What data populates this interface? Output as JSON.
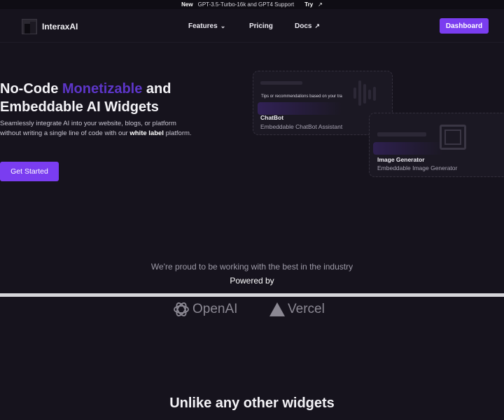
{
  "announcement": {
    "badge": "New",
    "text": "GPT-3.5-Turbo-16k and GPT4 Support",
    "link": "Try",
    "link_icon": "arrow-up-right-icon"
  },
  "nav": {
    "brand": "InteraxAI",
    "features": "Features",
    "pricing": "Pricing",
    "docs": "Docs",
    "dashboard": "Dashboard"
  },
  "hero": {
    "title_part1": "No-Code ",
    "title_accent": "Monetizable",
    "title_part2": " and",
    "title_line2": "Embeddable AI Widgets",
    "desc_part1": "Seamlessly integrate AI into your website, blogs, or platform without writing a single line of code with our ",
    "desc_bold": "white label",
    "desc_part2": " platform.",
    "cta": "Get Started"
  },
  "widgets": {
    "chat_prompt": "Tips or recommendations based on your tra",
    "chat_title": "ChatBot",
    "chat_subtitle": "Embeddable ChatBot Assistant",
    "image_title": "Image Generator",
    "image_subtitle": "Embeddable Image Generator"
  },
  "partners": {
    "proud_text": "We're proud to be working with the best in the industry",
    "powered_by": "Powered by",
    "openai": "OpenAI",
    "vercel": "Vercel"
  },
  "section": {
    "heading": "Unlike any other widgets"
  },
  "colors": {
    "accent": "#7a3df0",
    "background": "#16131d"
  }
}
